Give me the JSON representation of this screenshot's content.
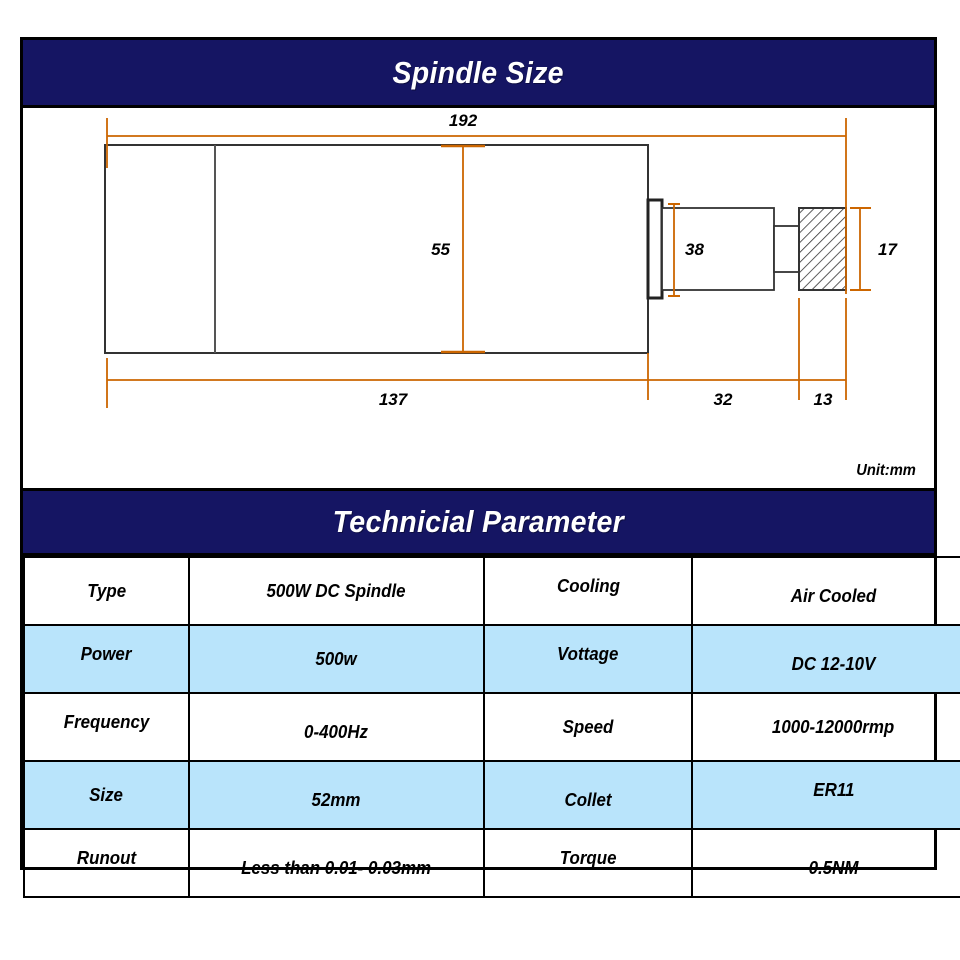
{
  "banners": {
    "spindle_size": "Spindle Size",
    "technical_parameter": "Technicial Parameter"
  },
  "drawing": {
    "unit_label": "Unit:mm",
    "dimensions": {
      "overall_length": "192",
      "body_height": "55",
      "body_length": "137",
      "shaft_diameter": "38",
      "collet_nut": "17",
      "nose_length": "32",
      "nut_length": "13"
    },
    "colors": {
      "dimension_line": "#cc6600",
      "outline": "#333333",
      "hatch": "#333333"
    }
  },
  "spec_table": {
    "rows": [
      {
        "label_a": "Type",
        "value_a": "500W DC Spindle",
        "label_b": "Cooling",
        "value_b": "Air Cooled",
        "shaded": false
      },
      {
        "label_a": "Power",
        "value_a": "500w",
        "label_b": "Vottage",
        "value_b": "DC 12-10V",
        "shaded": true
      },
      {
        "label_a": "Frequency",
        "value_a": "0-400Hz",
        "label_b": "Speed",
        "value_b": "1000-12000rmp",
        "shaded": false
      },
      {
        "label_a": "Size",
        "value_a": "52mm",
        "label_b": "Collet",
        "value_b": "ER11",
        "shaded": true
      },
      {
        "label_a": "Runout",
        "value_a": "Less than 0.01- 0.03mm",
        "label_b": "Torque",
        "value_b": "0.5NM",
        "shaded": false
      }
    ]
  },
  "theme": {
    "banner_bg": "#151563",
    "banner_text": "#ffffff",
    "row_shade": "#b9e4fb",
    "border": "#000000"
  }
}
